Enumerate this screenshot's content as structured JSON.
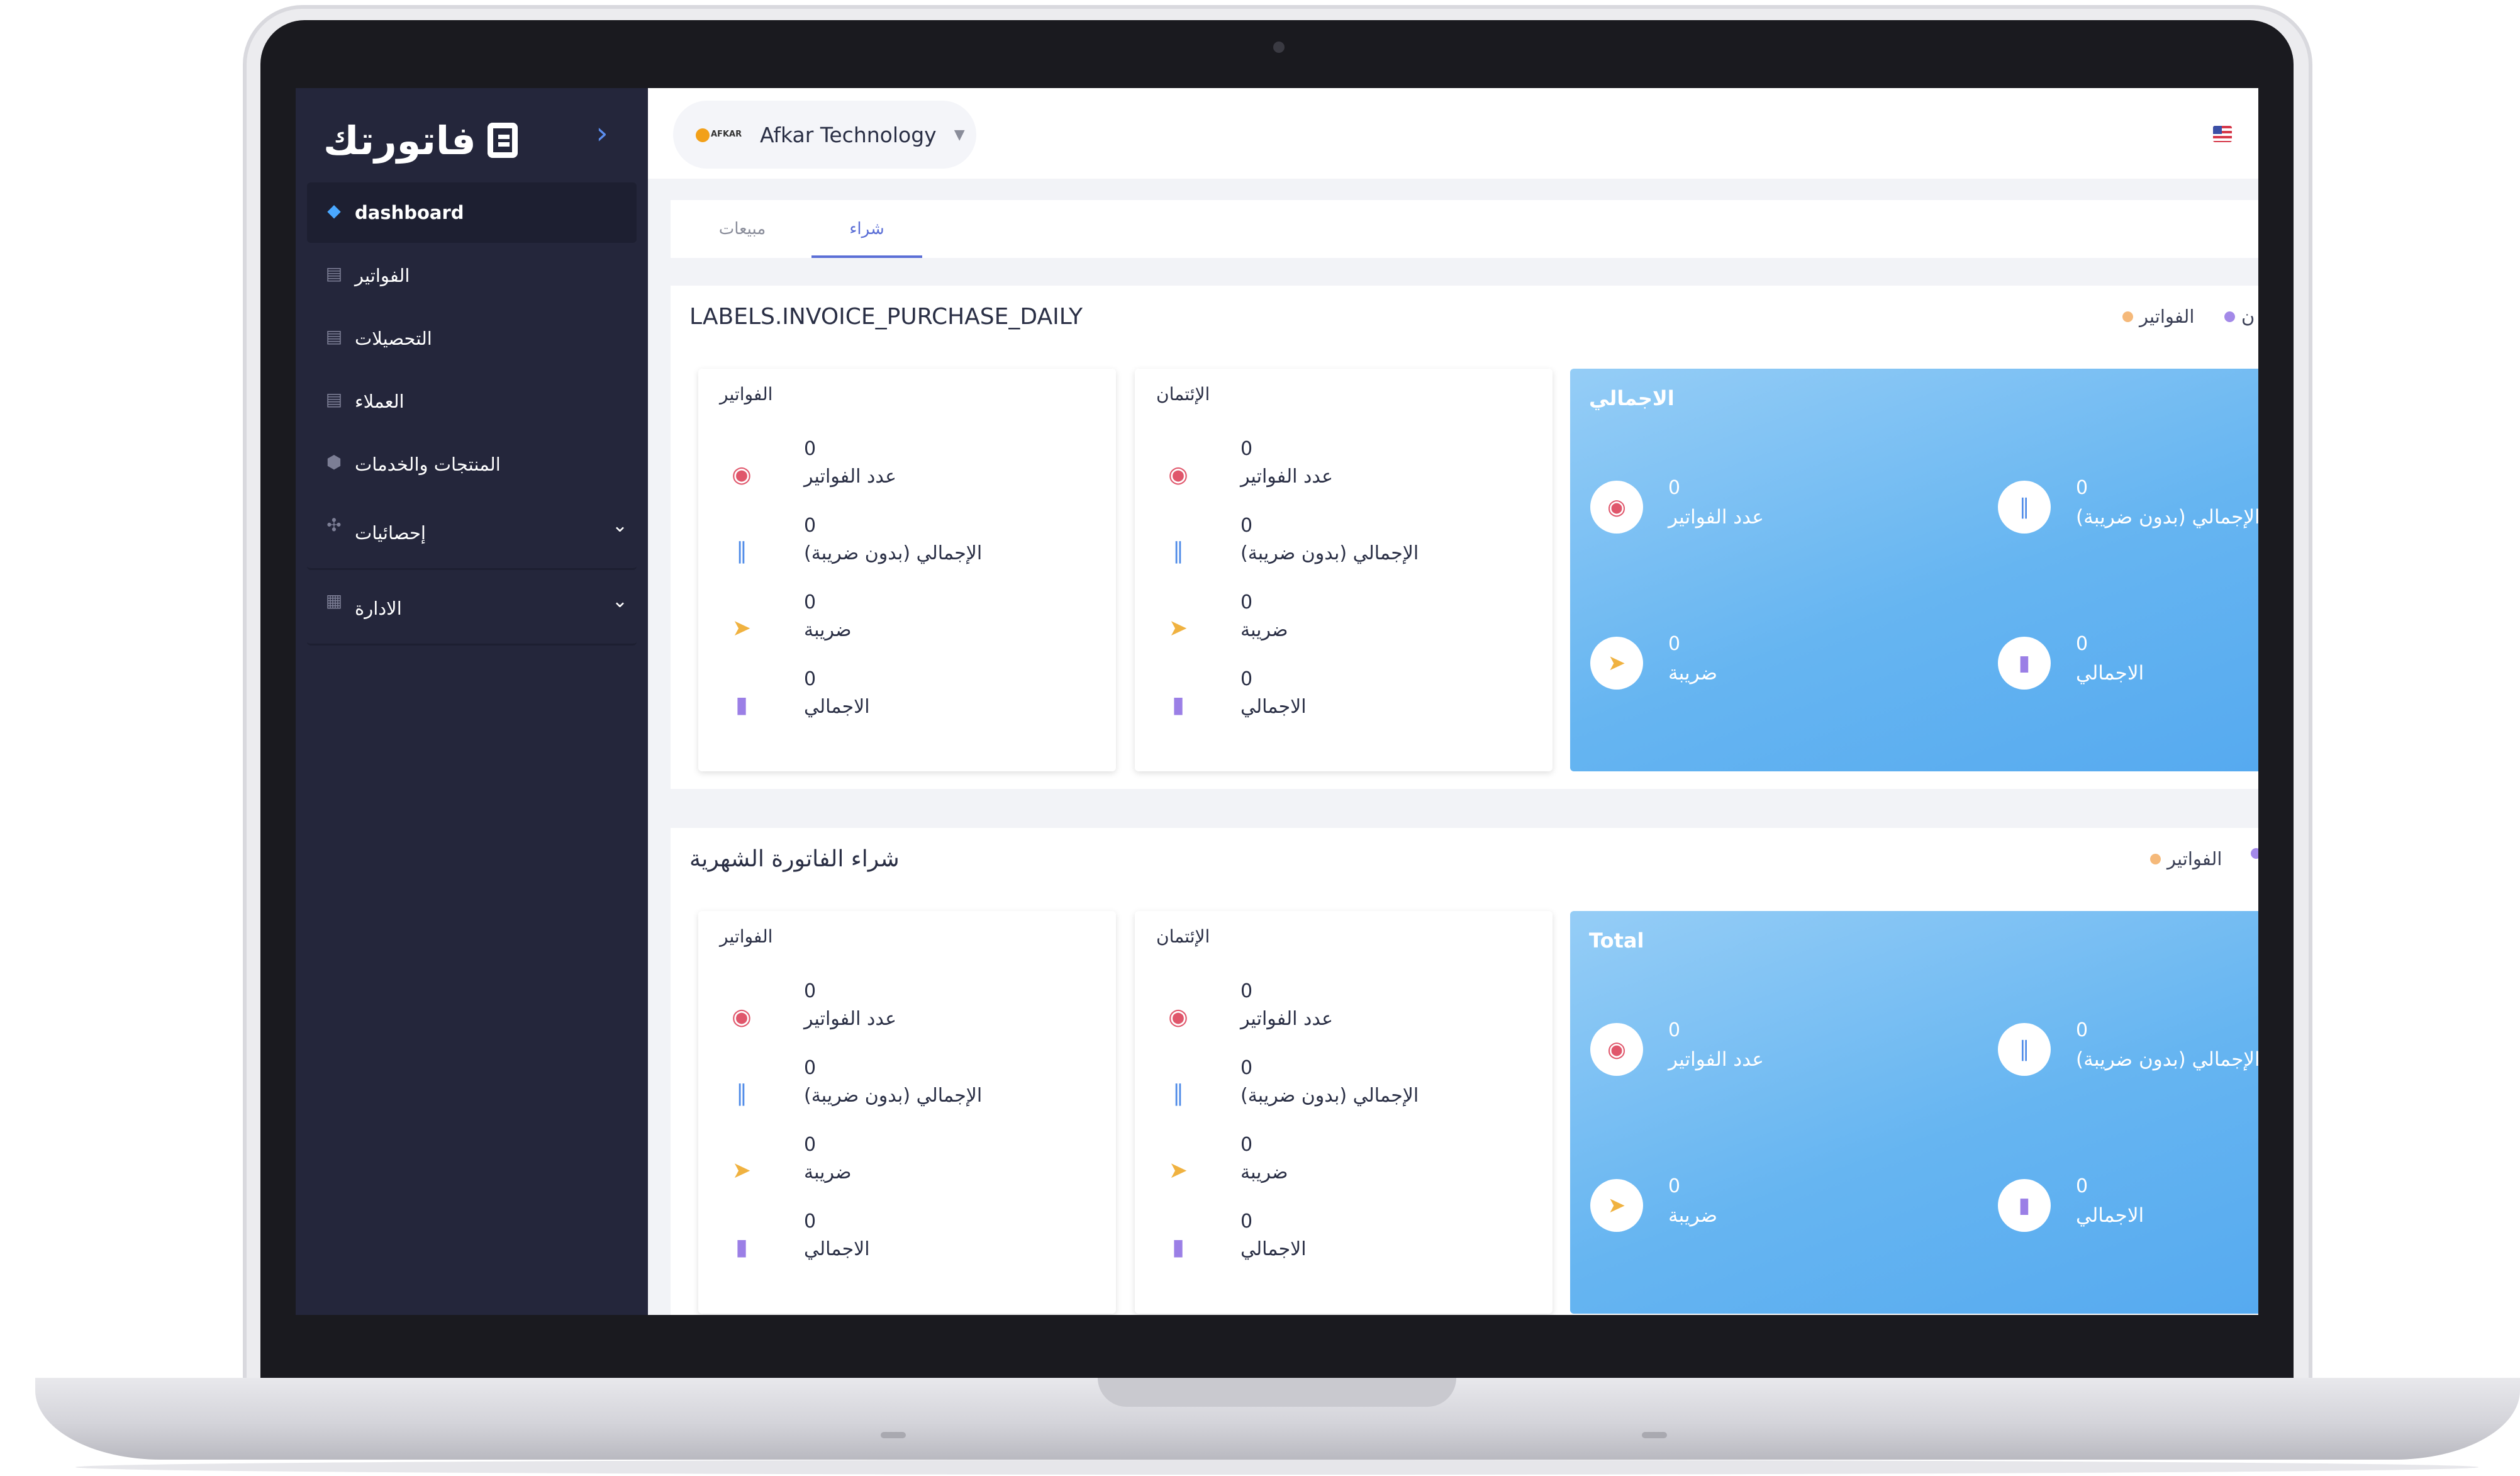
{
  "app": {
    "logo_text": "فاتورتك",
    "collapse_glyph": "›"
  },
  "sidebar": {
    "items": [
      {
        "label": "dashboard",
        "icon": "diamond-icon"
      },
      {
        "label": "الفواتير",
        "icon": "document-icon"
      },
      {
        "label": "التحصيلات",
        "icon": "document-icon"
      },
      {
        "label": "العملاء",
        "icon": "document-icon"
      },
      {
        "label": "المنتجات والخدمات",
        "icon": "box-icon"
      },
      {
        "label": "إحصائيات",
        "icon": "chart-icon"
      },
      {
        "label": "الادارة",
        "icon": "grid-icon"
      }
    ]
  },
  "header": {
    "company_name": "Afkar Technology",
    "company_logo_text": "AFKAR"
  },
  "tabs": [
    {
      "label": "مبيعات"
    },
    {
      "label": "شراء"
    }
  ],
  "colors": {
    "accent": "#5b6fd6",
    "sidebar_bg": "#24263b",
    "legend_invoices": "#f5b97a",
    "legend_second": "#a389e8"
  },
  "daily": {
    "title": "LABELS.INVOICE_PURCHASE_DAILY",
    "legend": [
      "الفواتير",
      "ن"
    ],
    "cards": [
      {
        "title": "الفواتير",
        "rows": [
          {
            "value": "0",
            "label": "عدد الفواتير"
          },
          {
            "value": "0",
            "label": "الإجمالي (بدون ضريبة)"
          },
          {
            "value": "0",
            "label": "ضريبة"
          },
          {
            "value": "0",
            "label": "الاجمالي"
          }
        ]
      },
      {
        "title": "الإئتمان",
        "rows": [
          {
            "value": "0",
            "label": "عدد الفواتير"
          },
          {
            "value": "0",
            "label": "الإجمالي (بدون ضريبة)"
          },
          {
            "value": "0",
            "label": "ضريبة"
          },
          {
            "value": "0",
            "label": "الاجمالي"
          }
        ]
      }
    ],
    "total": {
      "title": "الاجمالي",
      "stats": [
        {
          "value": "0",
          "label": "عدد الفواتير"
        },
        {
          "value": "0",
          "label": "الإجمالي (بدون ضريبة)"
        },
        {
          "value": "0",
          "label": "ضريبة"
        },
        {
          "value": "0",
          "label": "الاجمالي"
        }
      ]
    }
  },
  "monthly": {
    "title": "شراء الفاتورة الشهرية",
    "legend": [
      "الفواتير"
    ],
    "cards": [
      {
        "title": "الفواتير",
        "rows": [
          {
            "value": "0",
            "label": "عدد الفواتير"
          },
          {
            "value": "0",
            "label": "الإجمالي (بدون ضريبة)"
          },
          {
            "value": "0",
            "label": "ضريبة"
          },
          {
            "value": "0",
            "label": "الاجمالي"
          }
        ]
      },
      {
        "title": "الإئتمان",
        "rows": [
          {
            "value": "0",
            "label": "عدد الفواتير"
          },
          {
            "value": "0",
            "label": "الإجمالي (بدون ضريبة)"
          },
          {
            "value": "0",
            "label": "ضريبة"
          },
          {
            "value": "0",
            "label": "الاجمالي"
          }
        ]
      }
    ],
    "total": {
      "title": "Total",
      "stats": [
        {
          "value": "0",
          "label": "عدد الفواتير"
        },
        {
          "value": "0",
          "label": "الإجمالي (بدون ضريبة)"
        },
        {
          "value": "0",
          "label": "ضريبة"
        },
        {
          "value": "0",
          "label": "الاجمالي"
        }
      ]
    }
  }
}
